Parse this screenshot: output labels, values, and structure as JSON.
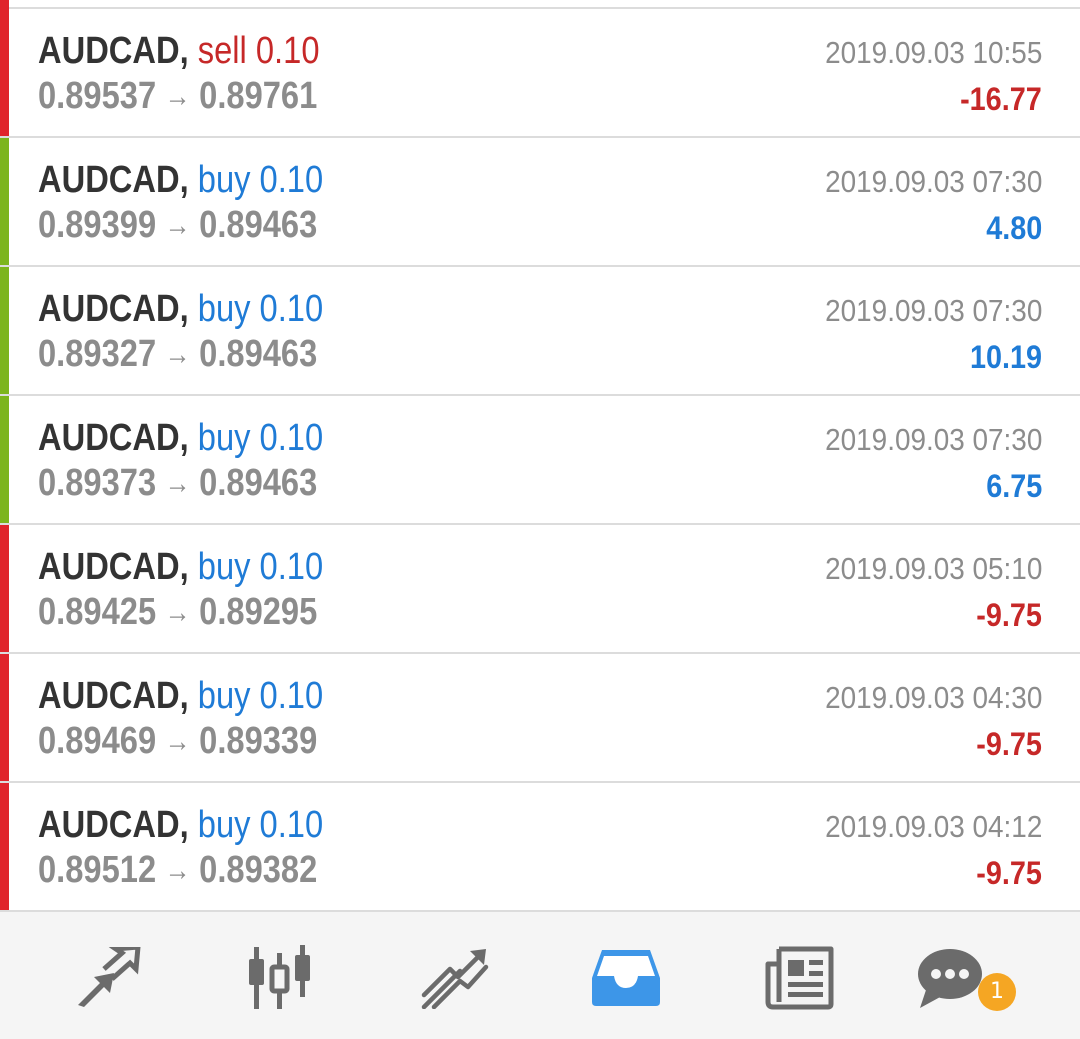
{
  "deals": [
    {
      "symbol": "AUDCAD,",
      "type": "sell 0.10",
      "side": "sell",
      "open_price": "0.89537",
      "close_price": "0.89761",
      "time": "2019.09.03 10:55",
      "profit": "-16.77",
      "result": "loss"
    },
    {
      "symbol": "AUDCAD,",
      "type": "buy 0.10",
      "side": "buy",
      "open_price": "0.89399",
      "close_price": "0.89463",
      "time": "2019.09.03 07:30",
      "profit": "4.80",
      "result": "profit"
    },
    {
      "symbol": "AUDCAD,",
      "type": "buy 0.10",
      "side": "buy",
      "open_price": "0.89327",
      "close_price": "0.89463",
      "time": "2019.09.03 07:30",
      "profit": "10.19",
      "result": "profit"
    },
    {
      "symbol": "AUDCAD,",
      "type": "buy 0.10",
      "side": "buy",
      "open_price": "0.89373",
      "close_price": "0.89463",
      "time": "2019.09.03 07:30",
      "profit": "6.75",
      "result": "profit"
    },
    {
      "symbol": "AUDCAD,",
      "type": "buy 0.10",
      "side": "buy",
      "open_price": "0.89425",
      "close_price": "0.89295",
      "time": "2019.09.03 05:10",
      "profit": "-9.75",
      "result": "loss"
    },
    {
      "symbol": "AUDCAD,",
      "type": "buy 0.10",
      "side": "buy",
      "open_price": "0.89469",
      "close_price": "0.89339",
      "time": "2019.09.03 04:30",
      "profit": "-9.75",
      "result": "loss"
    },
    {
      "symbol": "AUDCAD,",
      "type": "buy 0.10",
      "side": "buy",
      "open_price": "0.89512",
      "close_price": "0.89382",
      "time": "2019.09.03 04:12",
      "profit": "-9.75",
      "result": "loss"
    }
  ],
  "arrow_glyph": "→",
  "bottom_nav": {
    "items": [
      {
        "icon": "quotes-icon",
        "active": false
      },
      {
        "icon": "chart-icon",
        "active": false
      },
      {
        "icon": "trade-icon",
        "active": false
      },
      {
        "icon": "history-icon",
        "active": true
      },
      {
        "icon": "news-icon",
        "active": false
      },
      {
        "icon": "messages-icon",
        "active": false
      }
    ],
    "messages_badge": "1"
  },
  "colors": {
    "loss_stripe": "#e0242b",
    "profit_stripe": "#7cb51d",
    "buy_text": "#1f7bd6",
    "sell_text": "#c62828",
    "active_icon": "#3d96e8",
    "inactive_icon": "#6b6b6b",
    "badge": "#f5a623"
  }
}
